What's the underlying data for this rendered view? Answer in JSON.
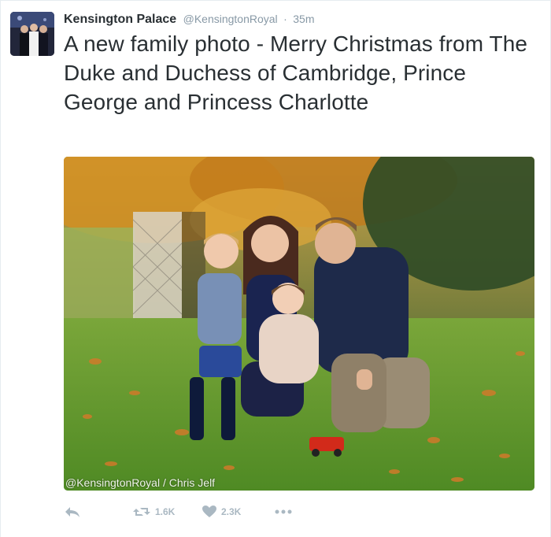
{
  "tweet": {
    "display_name": "Kensington Palace",
    "handle": "@KensingtonRoyal",
    "separator": "·",
    "time": "35m",
    "text": "A new family photo - Merry Christmas from The Duke and Duchess of Cambridge, Prince George and Princess Charlotte"
  },
  "media": {
    "credit": "@KensingtonRoyal / Chris Jelf"
  },
  "actions": {
    "retweet_count": "1.6K",
    "like_count": "2.3K"
  },
  "icons": [
    "reply-icon",
    "retweet-icon",
    "heart-icon",
    "more-icon"
  ],
  "colors": {
    "text": "#292f33",
    "muted": "#8899a6",
    "action_icon": "#aab8c2"
  }
}
